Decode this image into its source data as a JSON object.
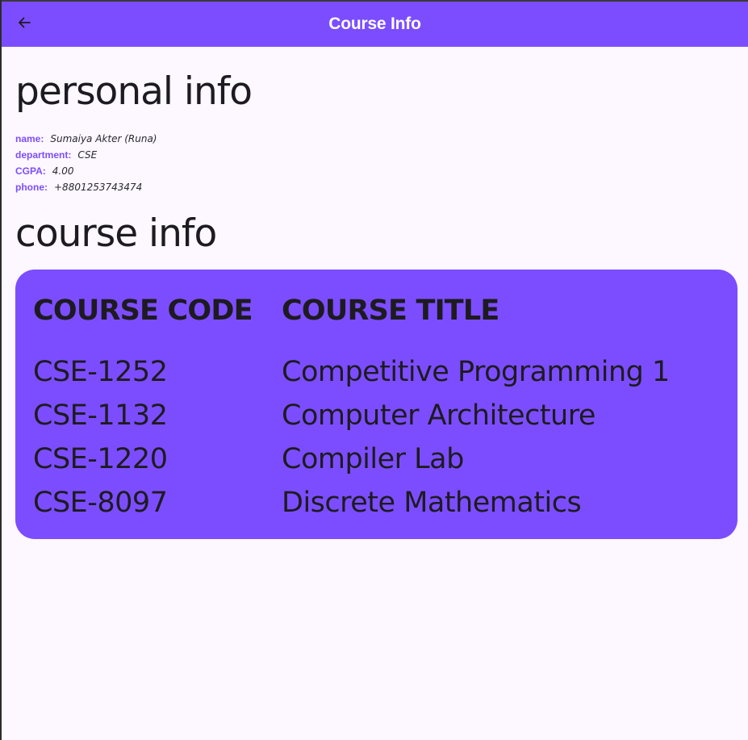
{
  "appbar": {
    "title": "Course Info",
    "back_icon": "arrow-left-icon",
    "color": "#7c4dff"
  },
  "personal": {
    "heading": "personal info",
    "fields": [
      {
        "label": "name:",
        "value": "Sumaiya Akter (Runa)"
      },
      {
        "label": "department:",
        "value": "CSE"
      },
      {
        "label": "CGPA:",
        "value": "4.00"
      },
      {
        "label": "phone:",
        "value": "+8801253743474"
      }
    ]
  },
  "course": {
    "heading": "course info",
    "columns": [
      "COURSE CODE",
      "COURSE TITLE"
    ],
    "rows": [
      {
        "code": "CSE-1252",
        "title": "Competitive Programming 1"
      },
      {
        "code": "CSE-1132",
        "title": "Computer Architecture"
      },
      {
        "code": "CSE-1220",
        "title": "Compiler Lab"
      },
      {
        "code": "CSE-8097",
        "title": "Discrete Mathematics"
      }
    ],
    "card_color": "#7c4dff"
  }
}
